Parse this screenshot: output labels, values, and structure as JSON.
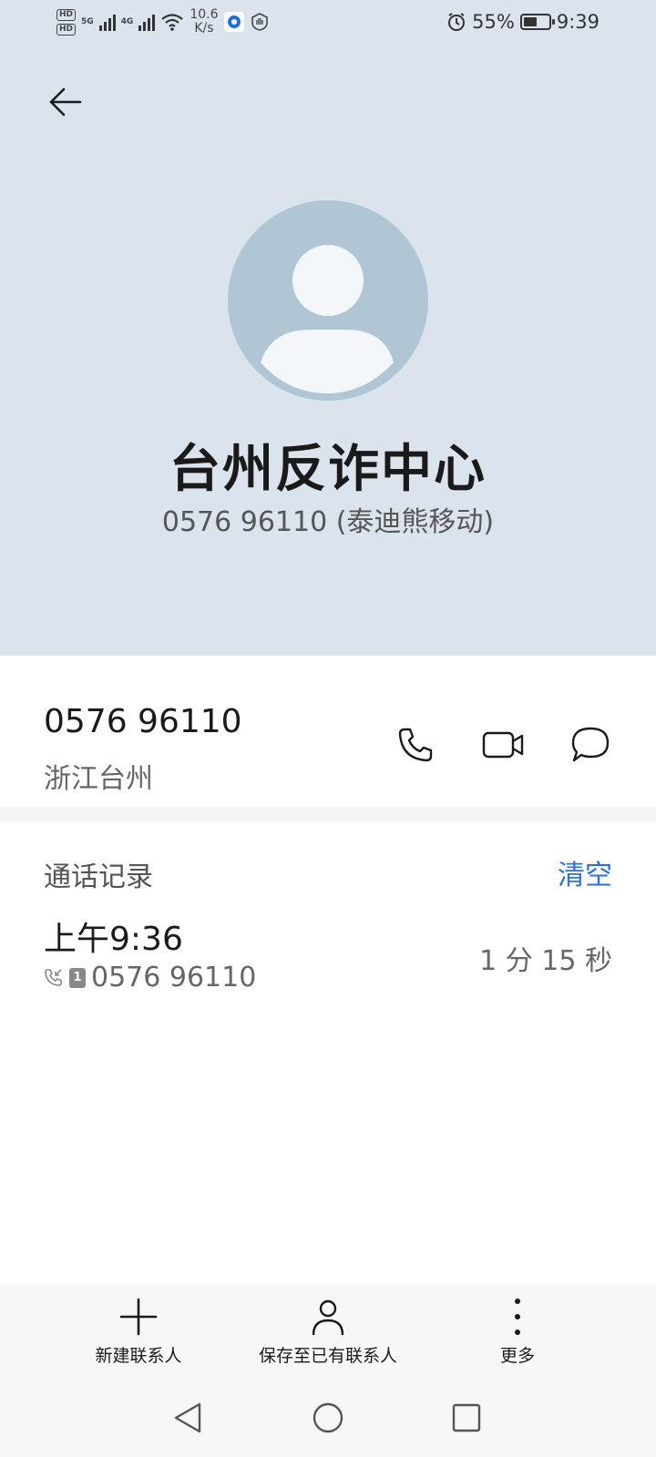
{
  "status_bar": {
    "hd_label": "HD",
    "network_5g": "5G",
    "network_4g": "4G",
    "speed_value": "10.6",
    "speed_unit": "K/s",
    "battery_percent": "55%",
    "battery_level": 0.55,
    "time": "9:39"
  },
  "contact": {
    "name": "台州反诈中心",
    "subtitle": "0576 96110 (泰迪熊移动)"
  },
  "number_card": {
    "number": "0576 96110",
    "location": "浙江台州",
    "actions": [
      {
        "icon": "phone-icon",
        "label": "call"
      },
      {
        "icon": "video-call-icon",
        "label": "video"
      },
      {
        "icon": "message-icon",
        "label": "message"
      }
    ]
  },
  "call_log": {
    "title": "通话记录",
    "clear_label": "清空",
    "entries": [
      {
        "time": "上午9:36",
        "sim": "1",
        "number": "0576 96110",
        "duration": "1 分 15 秒",
        "type_icon": "incoming-call-icon"
      }
    ]
  },
  "bottom_actions": {
    "new_contact": "新建联系人",
    "save_to_existing": "保存至已有联系人",
    "more": "更多"
  },
  "colors": {
    "header_bg": "#dbe3ed",
    "avatar_bg": "#b0c6d4",
    "accent": "#2f6fd8"
  }
}
